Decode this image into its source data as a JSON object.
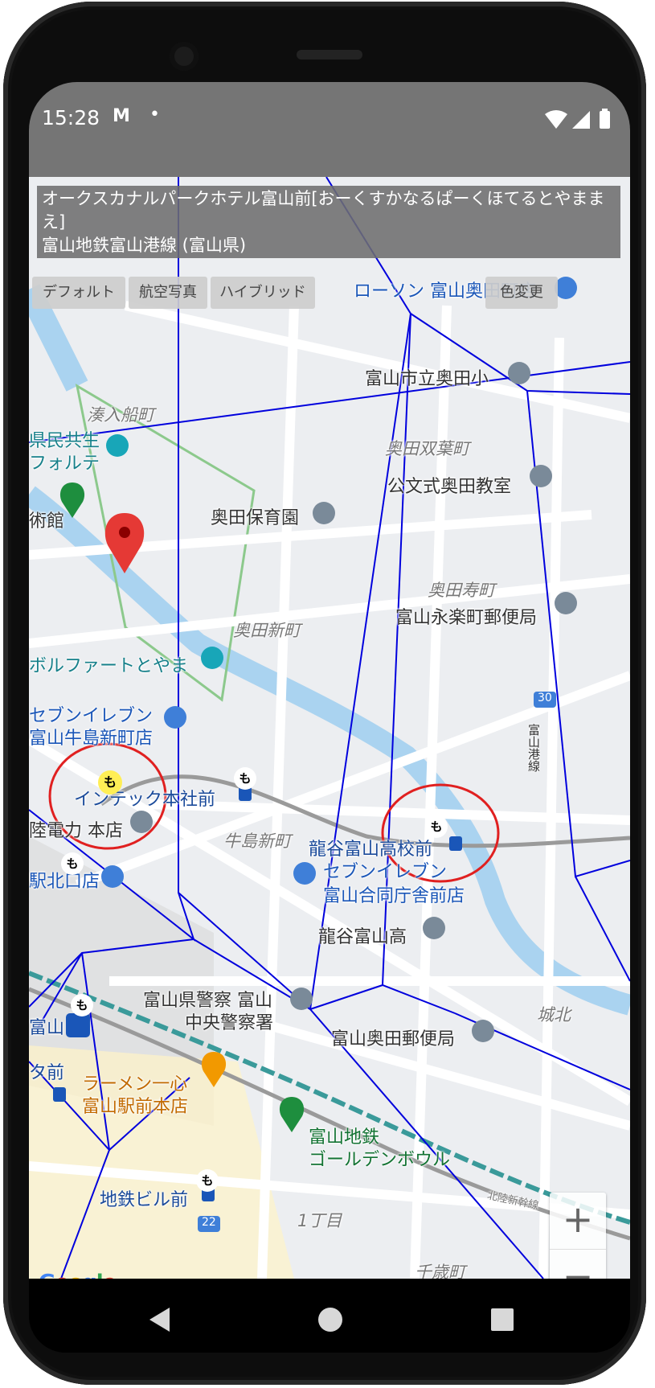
{
  "status_bar": {
    "time": "15:28",
    "notif_icon": "M",
    "dot": "•"
  },
  "info_box": {
    "line1": "オークスカナルパークホテル富山前[おーくすかなるぱーくほてるとやままえ]",
    "line2": "富山地鉄富山港線 (富山県)"
  },
  "map_types": {
    "default": "デフォルト",
    "aerial": "航空写真",
    "hybrid": "ハイブリッド"
  },
  "color_change": "色変更",
  "map_labels": {
    "minatoirifunecho": "湊入船町",
    "kenmin_1": "県民共生",
    "kenmin_2": "フォルテ",
    "kan": "術館",
    "okuda_hoikuen": "奥田保育園",
    "okuda_futabacho": "奥田双葉町",
    "kumon": "公文式奥田教室",
    "lawson": "ローソン 富山奥田町店",
    "shiritsu": "富山市立奥田小",
    "okuda_kotobukicho": "奥田寿町",
    "eiraku_post": "富山永楽町郵便局",
    "okuda_shinmachi": "奥田新町",
    "borufaato": "ボルファートとやま",
    "seven1_a": "セブンイレブン",
    "seven1_b": "富山牛島新町店",
    "intec": "インテック本社前",
    "hokuriku": "陸電力 本店",
    "ushijima": "牛島新町",
    "ryukoku_mae": "龍谷富山高校前",
    "seven2_a": "セブンイレブン",
    "seven2_b": "富山合同庁舎前店",
    "ekikitaguchi": "駅北口店",
    "ryukoku": "龍谷富山高",
    "police_a": "富山県警察 富山",
    "police_b": "中央警察署",
    "okuda_post": "富山奥田郵便局",
    "johoku": "城北",
    "toyama": "富山",
    "ta_mae": "タ前",
    "ramen_a": "ラーメン一心",
    "ramen_b": "富山駅前本店",
    "golden_a": "富山地鉄",
    "golden_b": "ゴールデンボウル",
    "chitetsu_building": "地鉄ビル前",
    "itchome": "1丁目",
    "route30": "30",
    "route22": "22",
    "toyama_bypass": "富山港線",
    "hokuriku_shinkansen": "北陸新幹線",
    "chiba": "千歳町",
    "stop_mo": "も",
    "google": "Google"
  },
  "zoom": {
    "in": "+",
    "out": "−"
  },
  "icons": [
    "wifi-icon",
    "signal-icon",
    "battery-icon",
    "map-marker-icon",
    "bus-stop-icon",
    "school-icon",
    "post-office-icon",
    "convenience-store-icon",
    "restaurant-icon",
    "police-icon",
    "park-icon"
  ],
  "colors": {
    "statusbar": "#757575",
    "voronoi": "#0000dd",
    "marker_red": "#e53935",
    "circle_red": "#e02020",
    "river": "#aad3f0"
  }
}
